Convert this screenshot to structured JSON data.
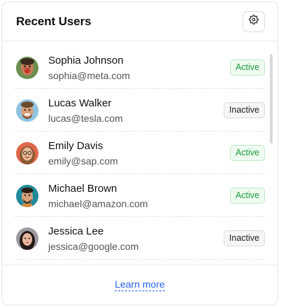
{
  "header": {
    "title": "Recent Users",
    "settings_icon": "gear-icon"
  },
  "users": [
    {
      "name": "Sophia Johnson",
      "email": "sophia@meta.com",
      "status": "Active"
    },
    {
      "name": "Lucas Walker",
      "email": "lucas@tesla.com",
      "status": "Inactive"
    },
    {
      "name": "Emily Davis",
      "email": "emily@sap.com",
      "status": "Active"
    },
    {
      "name": "Michael Brown",
      "email": "michael@amazon.com",
      "status": "Active"
    },
    {
      "name": "Jessica Lee",
      "email": "jessica@google.com",
      "status": "Inactive"
    }
  ],
  "footer": {
    "link_label": "Learn more"
  },
  "colors": {
    "active": "#1f9a3c",
    "link": "#2563eb"
  }
}
